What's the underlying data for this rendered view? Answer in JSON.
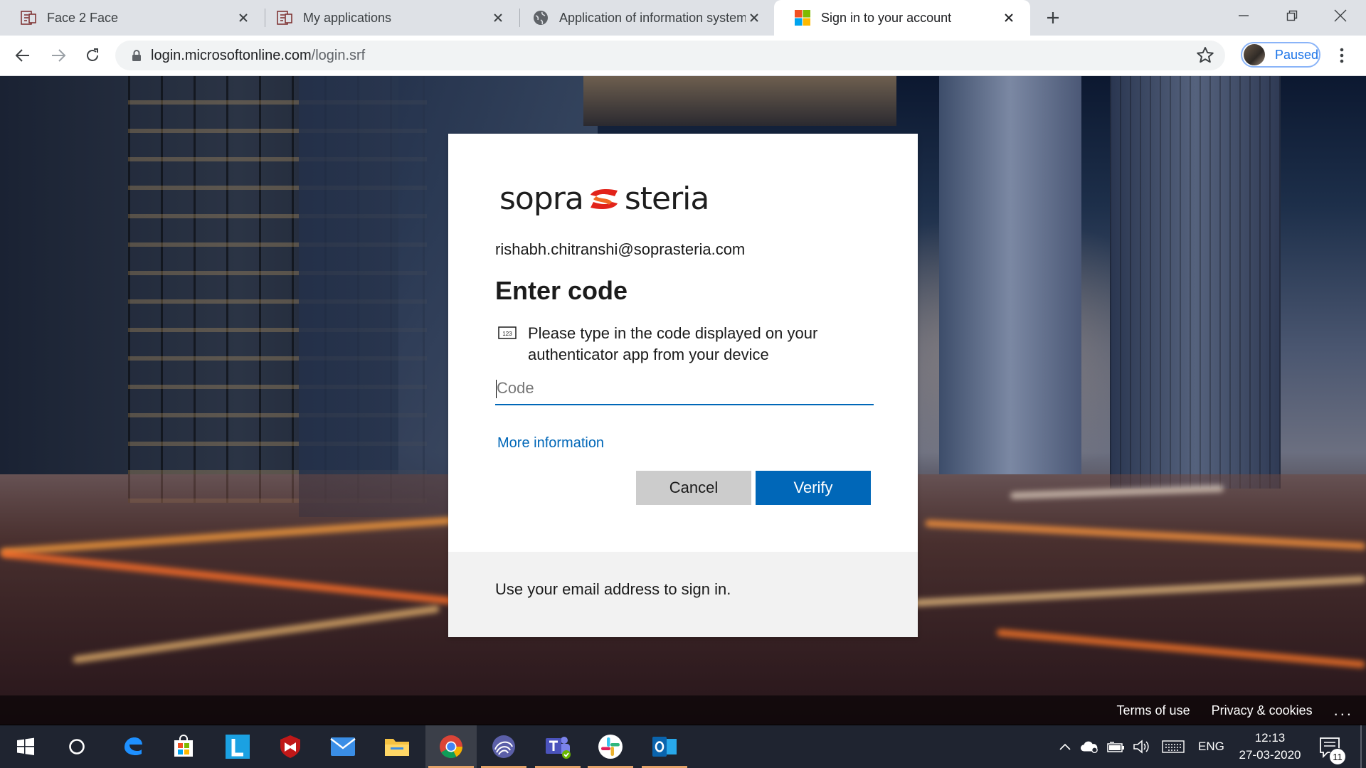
{
  "browser": {
    "tabs": [
      {
        "title": "Face 2 Face",
        "icon": "face2face-icon"
      },
      {
        "title": "My applications",
        "icon": "face2face-icon"
      },
      {
        "title": "Application of information system",
        "icon": "globe-icon"
      },
      {
        "title": "Sign in to your account",
        "icon": "microsoft-logo-icon",
        "active": true
      }
    ],
    "url_host": "login.microsoftonline.com",
    "url_path": "/login.srf",
    "profile_status": "Paused"
  },
  "signin": {
    "brand_left": "sopra",
    "brand_right": "steria",
    "identity": "rishabh.chitranshi@soprasteria.com",
    "title": "Enter code",
    "description": "Please type in the code displayed on your authenticator app from your device",
    "code_placeholder": "Code",
    "code_value": "",
    "more_info_link": "More information",
    "cancel_label": "Cancel",
    "verify_label": "Verify",
    "footer_text": "Use your email address to sign in.",
    "accent_color": "#0067b8"
  },
  "page_footer": {
    "terms": "Terms of use",
    "privacy": "Privacy & cookies",
    "more": "..."
  },
  "taskbar": {
    "apps": [
      "start-icon",
      "search-icon",
      "edge-icon",
      "store-icon",
      "l-app-icon",
      "mcafee-icon",
      "mail-icon",
      "file-explorer-icon",
      "chrome-icon",
      "app-swirl-icon",
      "teams-icon",
      "slack-icon",
      "outlook-icon"
    ],
    "language": "ENG",
    "time": "12:13",
    "date": "27-03-2020",
    "notification_count": "11"
  }
}
